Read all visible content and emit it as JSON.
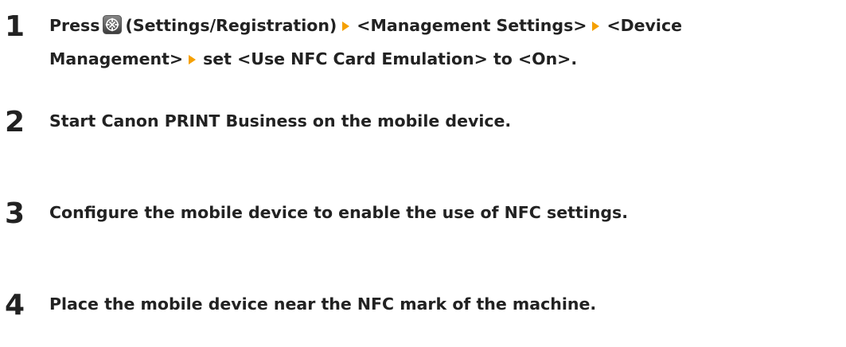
{
  "steps": [
    {
      "number": "1",
      "parts": {
        "press": "Press",
        "settings_label": "(Settings/Registration)",
        "menu_1": "<Management Settings>",
        "menu_2_line1": "<Device",
        "menu_2_line2": "Management>",
        "action": "set <Use NFC Card Emulation> to <On>."
      },
      "icon": "settings-registration-icon",
      "arrow_color": "#f5a000"
    },
    {
      "number": "2",
      "text": "Start Canon PRINT Business on the mobile device."
    },
    {
      "number": "3",
      "text": "Configure the mobile device to enable the use of NFC settings."
    },
    {
      "number": "4",
      "text": "Place the mobile device near the NFC mark of the machine."
    }
  ]
}
